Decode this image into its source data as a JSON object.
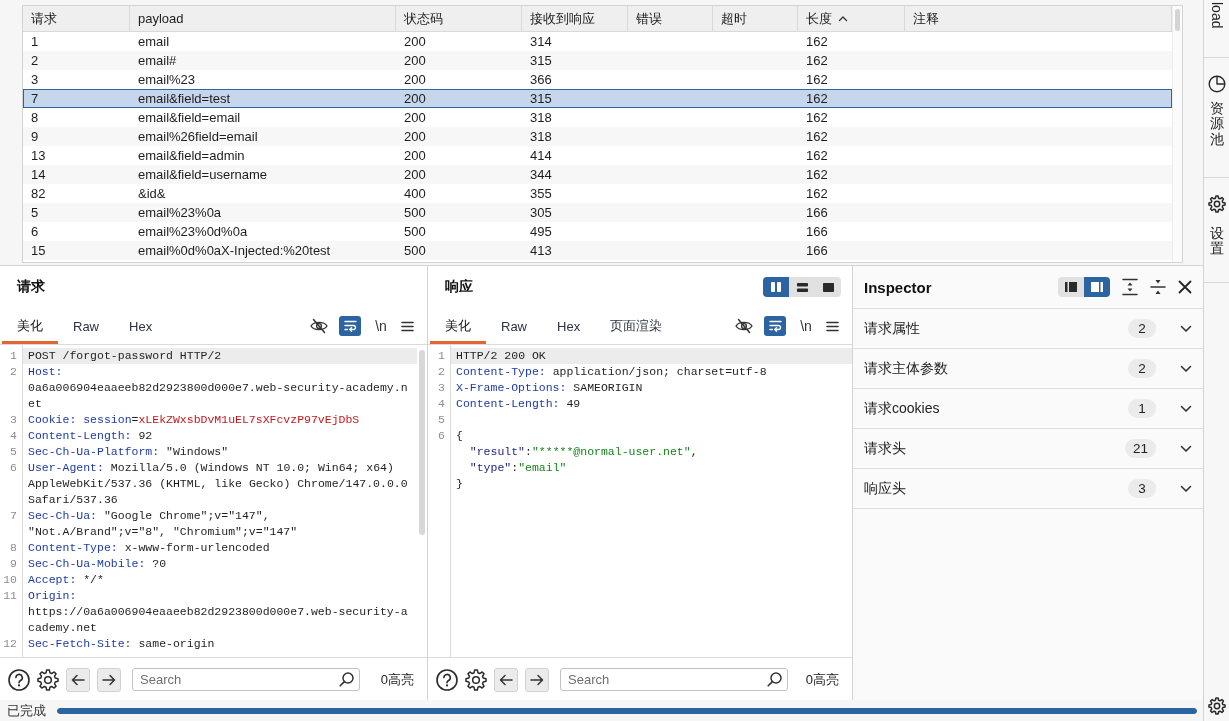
{
  "results_table": {
    "columns": [
      {
        "label": "请求",
        "sorted": false
      },
      {
        "label": "payload",
        "sorted": false
      },
      {
        "label": "状态码",
        "sorted": false
      },
      {
        "label": "接收到响应",
        "sorted": false
      },
      {
        "label": "错误",
        "sorted": false
      },
      {
        "label": "超时",
        "sorted": false
      },
      {
        "label": "长度",
        "sorted": true
      },
      {
        "label": "注释",
        "sorted": false
      }
    ],
    "rows": [
      {
        "request": "1",
        "payload": "email",
        "status_code": "200",
        "response_received": "314",
        "length": "162",
        "selected": false
      },
      {
        "request": "2",
        "payload": "email#",
        "status_code": "200",
        "response_received": "315",
        "length": "162",
        "selected": false
      },
      {
        "request": "3",
        "payload": "email%23",
        "status_code": "200",
        "response_received": "366",
        "length": "162",
        "selected": false
      },
      {
        "request": "7",
        "payload": "email&field=test",
        "status_code": "200",
        "response_received": "315",
        "length": "162",
        "selected": true
      },
      {
        "request": "8",
        "payload": "email&field=email",
        "status_code": "200",
        "response_received": "318",
        "length": "162",
        "selected": false
      },
      {
        "request": "9",
        "payload": "email%26field=email",
        "status_code": "200",
        "response_received": "318",
        "length": "162",
        "selected": false
      },
      {
        "request": "13",
        "payload": "email&field=admin",
        "status_code": "200",
        "response_received": "414",
        "length": "162",
        "selected": false
      },
      {
        "request": "14",
        "payload": "email&field=username",
        "status_code": "200",
        "response_received": "344",
        "length": "162",
        "selected": false
      },
      {
        "request": "82",
        "payload": "&id&",
        "status_code": "400",
        "response_received": "355",
        "length": "162",
        "selected": false
      },
      {
        "request": "5",
        "payload": "email%23%0a",
        "status_code": "500",
        "response_received": "305",
        "length": "166",
        "selected": false
      },
      {
        "request": "6",
        "payload": "email%23%0d%0a",
        "status_code": "500",
        "response_received": "495",
        "length": "166",
        "selected": false
      },
      {
        "request": "15",
        "payload": "email%0d%0aX-Injected:%20test",
        "status_code": "500",
        "response_received": "413",
        "length": "166",
        "selected": false
      }
    ]
  },
  "request_panel": {
    "title": "请求",
    "tabs": [
      {
        "label": "美化",
        "selected": true
      },
      {
        "label": "Raw",
        "selected": false
      },
      {
        "label": "Hex",
        "selected": false
      }
    ],
    "toggles": [
      {
        "kind": "hide",
        "on": false
      },
      {
        "kind": "wrap",
        "on": true
      },
      {
        "kind": "newlines",
        "label": "\\n",
        "on": false
      }
    ],
    "lines": [
      {
        "number": "1",
        "current": true,
        "segments": [
          {
            "kind": "text",
            "text": "POST /forgot-password HTTP/2"
          }
        ]
      },
      {
        "number": "2",
        "current": false,
        "segments": [
          {
            "kind": "header",
            "text": "Host:"
          },
          {
            "kind": "text",
            "text": " 0a6a006904eaaeeb82d2923800d000e7.web-security-academy.net"
          }
        ]
      },
      {
        "number": "3",
        "current": false,
        "segments": [
          {
            "kind": "header",
            "text": "Cookie:"
          },
          {
            "kind": "param",
            "text": " session"
          },
          {
            "kind": "text",
            "text": "="
          },
          {
            "kind": "secret",
            "text": "xLEkZWxsbDvM1uEL7sXFcvzP97vEjDbS"
          }
        ]
      },
      {
        "number": "4",
        "current": false,
        "segments": [
          {
            "kind": "header",
            "text": "Content-Length:"
          },
          {
            "kind": "text",
            "text": " 92"
          }
        ]
      },
      {
        "number": "5",
        "current": false,
        "segments": [
          {
            "kind": "header",
            "text": "Sec-Ch-Ua-Platform:"
          },
          {
            "kind": "text",
            "text": " \"Windows\""
          }
        ]
      },
      {
        "number": "6",
        "current": false,
        "segments": [
          {
            "kind": "header",
            "text": "User-Agent:"
          },
          {
            "kind": "text",
            "text": " Mozilla/5.0 (Windows NT 10.0; Win64; x64) AppleWebKit/537.36 (KHTML, like Gecko) Chrome/147.0.0.0 Safari/537.36"
          }
        ]
      },
      {
        "number": "7",
        "current": false,
        "segments": [
          {
            "kind": "header",
            "text": "Sec-Ch-Ua:"
          },
          {
            "kind": "text",
            "text": " \"Google Chrome\";v=\"147\", \"Not.A/Brand\";v=\"8\", \"Chromium\";v=\"147\""
          }
        ]
      },
      {
        "number": "8",
        "current": false,
        "segments": [
          {
            "kind": "header",
            "text": "Content-Type:"
          },
          {
            "kind": "text",
            "text": " x-www-form-urlencoded"
          }
        ]
      },
      {
        "number": "9",
        "current": false,
        "segments": [
          {
            "kind": "header",
            "text": "Sec-Ch-Ua-Mobile:"
          },
          {
            "kind": "text",
            "text": " ?0"
          }
        ]
      },
      {
        "number": "10",
        "current": false,
        "segments": [
          {
            "kind": "header",
            "text": "Accept:"
          },
          {
            "kind": "text",
            "text": " */*"
          }
        ]
      },
      {
        "number": "11",
        "current": false,
        "segments": [
          {
            "kind": "header",
            "text": "Origin:"
          },
          {
            "kind": "text",
            "text": " https://0a6a006904eaaeeb82d2923800d000e7.web-security-academy.net"
          }
        ]
      },
      {
        "number": "12",
        "current": false,
        "segments": [
          {
            "kind": "header",
            "text": "Sec-Fetch-Site:"
          },
          {
            "kind": "text",
            "text": " same-origin"
          }
        ]
      }
    ],
    "search": {
      "placeholder": "Search",
      "highlights": "0高亮"
    }
  },
  "response_panel": {
    "title": "响应",
    "view_modes": [
      {
        "kind": "columns",
        "selected": true
      },
      {
        "kind": "rows",
        "selected": false
      },
      {
        "kind": "single",
        "selected": false
      }
    ],
    "tabs": [
      {
        "label": "美化",
        "selected": true
      },
      {
        "label": "Raw",
        "selected": false
      },
      {
        "label": "Hex",
        "selected": false
      },
      {
        "label": "页面渲染",
        "selected": false
      }
    ],
    "toggles": [
      {
        "kind": "hide",
        "on": false
      },
      {
        "kind": "wrap",
        "on": true
      },
      {
        "kind": "newlines",
        "label": "\\n",
        "on": false
      }
    ],
    "lines": [
      {
        "number": "1",
        "current": true,
        "segments": [
          {
            "kind": "text",
            "text": "HTTP/2 200 OK"
          }
        ]
      },
      {
        "number": "2",
        "current": false,
        "segments": [
          {
            "kind": "header",
            "text": "Content-Type:"
          },
          {
            "kind": "text",
            "text": " application/json; charset=utf-8"
          }
        ]
      },
      {
        "number": "3",
        "current": false,
        "segments": [
          {
            "kind": "header",
            "text": "X-Frame-Options:"
          },
          {
            "kind": "text",
            "text": " SAMEORIGIN"
          }
        ]
      },
      {
        "number": "4",
        "current": false,
        "segments": [
          {
            "kind": "header",
            "text": "Content-Length:"
          },
          {
            "kind": "text",
            "text": " 49"
          }
        ]
      },
      {
        "number": "5",
        "current": false
      },
      {
        "number": "6",
        "current": false,
        "segments": [
          {
            "kind": "punct",
            "text": "{\n  "
          },
          {
            "kind": "key",
            "text": "\"result\""
          },
          {
            "kind": "punct",
            "text": ":"
          },
          {
            "kind": "string",
            "text": "\"*****@normal-user.net\""
          },
          {
            "kind": "punct",
            "text": ",\n  "
          },
          {
            "kind": "key",
            "text": "\"type\""
          },
          {
            "kind": "punct",
            "text": ":"
          },
          {
            "kind": "string",
            "text": "\"email\""
          },
          {
            "kind": "punct",
            "text": "\n}"
          }
        ]
      }
    ],
    "search": {
      "placeholder": "Search",
      "highlights": "0高亮"
    }
  },
  "inspector": {
    "title": "Inspector",
    "layouts": [
      {
        "kind": "left",
        "selected": false
      },
      {
        "kind": "right",
        "selected": true
      }
    ],
    "sections": [
      {
        "label": "请求属性",
        "count": "2",
        "expanded": false
      },
      {
        "label": "请求主体参数",
        "count": "2",
        "expanded": false
      },
      {
        "label": "请求cookies",
        "count": "1",
        "expanded": false
      },
      {
        "label": "请求头",
        "count": "21",
        "expanded": false
      },
      {
        "label": "响应头",
        "count": "3",
        "expanded": false
      }
    ]
  },
  "side_tabs": [
    {
      "label": "load",
      "kind": "plain"
    },
    {
      "label": "资源池",
      "kind": "pool"
    },
    {
      "label": "设置",
      "kind": "settings"
    }
  ],
  "status_bar": {
    "status": "已完成",
    "progress": {
      "level": 1
    }
  }
}
